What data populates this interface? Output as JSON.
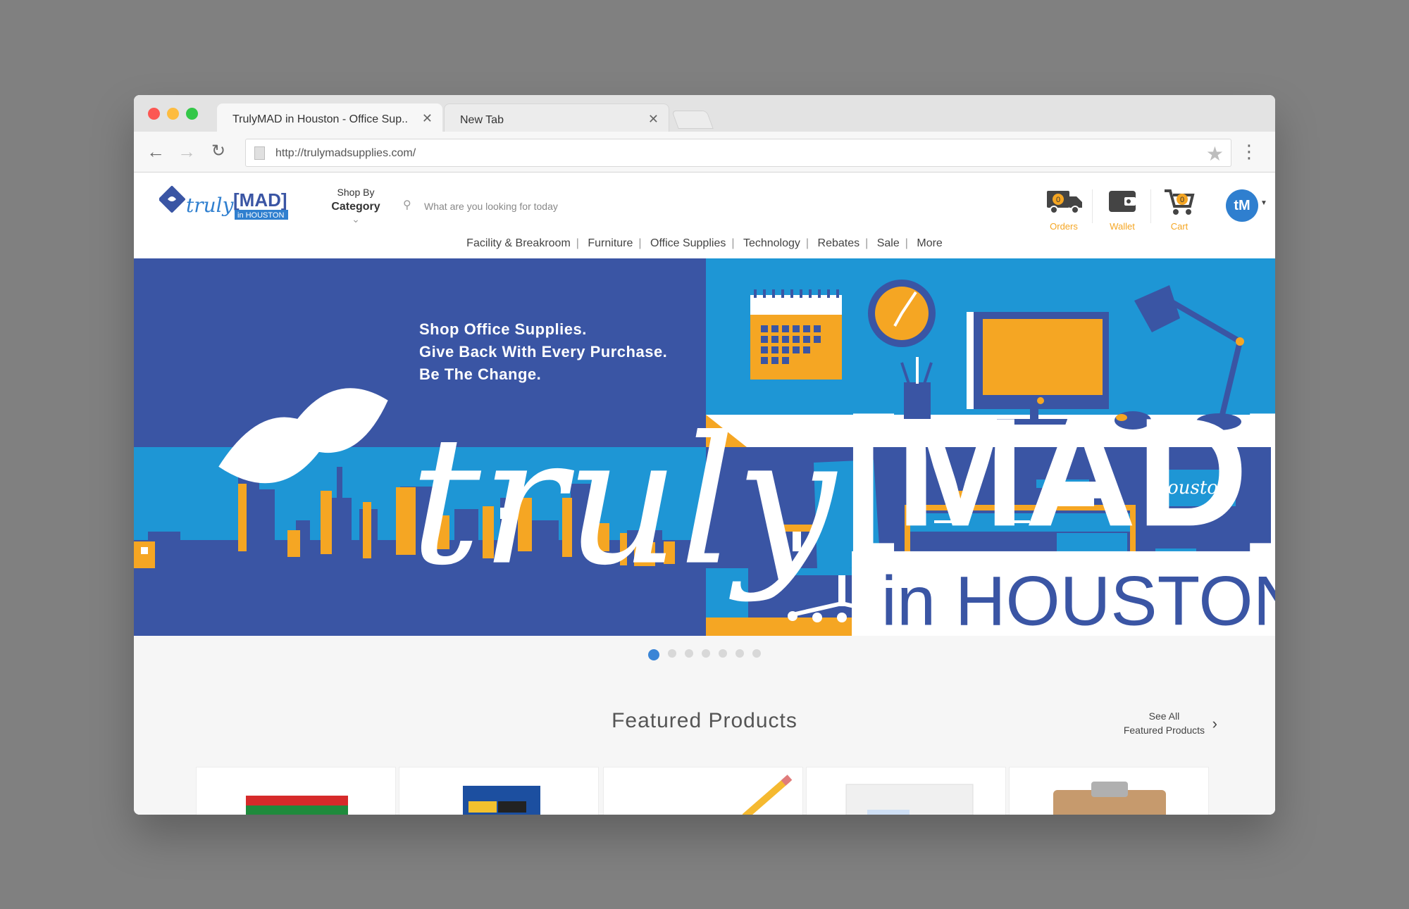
{
  "browser": {
    "tabs": [
      {
        "title": "TrulyMAD in Houston - Office Sup..",
        "close": "✕"
      },
      {
        "title": "New Tab",
        "close": "✕"
      }
    ],
    "url": "http://trulymadsupplies.com/"
  },
  "logo": {
    "word1": "truly",
    "word2": "[MAD]",
    "word3": "in HOUSTON"
  },
  "shop_by": {
    "line1": "Shop By",
    "line2": "Category"
  },
  "search": {
    "placeholder": "What are you looking for today"
  },
  "actions": [
    {
      "label": "Orders",
      "count": "0"
    },
    {
      "label": "Wallet"
    },
    {
      "label": "Cart",
      "count": "0"
    }
  ],
  "avatar": {
    "initials": "tM"
  },
  "categories": [
    "Facility & Breakroom",
    "Furniture",
    "Office Supplies",
    "Technology",
    "Rebates",
    "Sale",
    "More"
  ],
  "hero": {
    "lines": [
      "Shop Office Supplies.",
      "Give Back With Every Purchase.",
      "Be The Change."
    ],
    "sign": "houston"
  },
  "carousel": {
    "count": 7,
    "active": 0
  },
  "featured": {
    "title": "Featured Products",
    "see_all_line1": "See All",
    "see_all_line2": "Featured Products"
  },
  "colors": {
    "navy": "#3a55a4",
    "sky": "#1e96d5",
    "orange": "#f5a623",
    "blue_accent": "#2f7fcf"
  }
}
